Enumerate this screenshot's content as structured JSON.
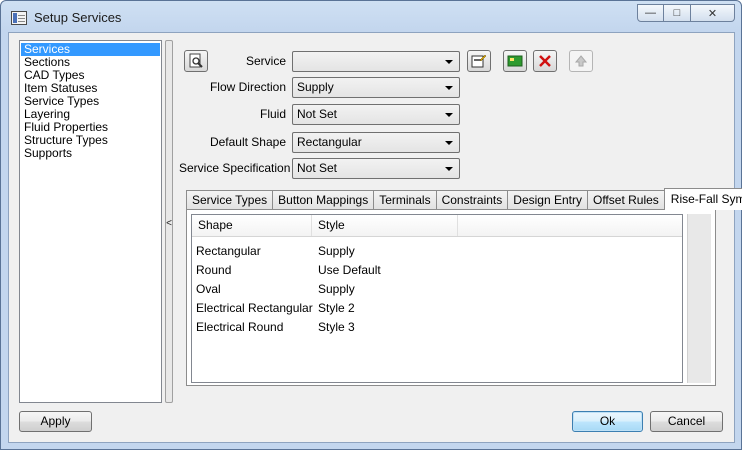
{
  "window": {
    "title": "Setup Services",
    "minimize_glyph": "—",
    "maximize_glyph": "□",
    "close_glyph": "✕"
  },
  "nav": {
    "items": [
      "Services",
      "Sections",
      "CAD Types",
      "Item Statuses",
      "Service Types",
      "Layering",
      "Fluid Properties",
      "Structure Types",
      "Supports"
    ],
    "selected": "Services"
  },
  "splitter": {
    "collapse_glyph": "<"
  },
  "form": {
    "service": {
      "label": "Service",
      "value": ""
    },
    "flow_direction": {
      "label": "Flow Direction",
      "value": "Supply"
    },
    "fluid": {
      "label": "Fluid",
      "value": "Not Set"
    },
    "default_shape": {
      "label": "Default Shape",
      "value": "Rectangular"
    },
    "service_specification": {
      "label": "Service Specification",
      "value": "Not Set"
    }
  },
  "tabs": {
    "items": [
      "Service Types",
      "Button Mappings",
      "Terminals",
      "Constraints",
      "Design Entry",
      "Offset Rules",
      "Rise-Fall Symbols"
    ],
    "active": "Rise-Fall Symbols"
  },
  "grid": {
    "columns": [
      "Shape",
      "Style"
    ],
    "rows": [
      [
        "Rectangular",
        "Supply"
      ],
      [
        "Round",
        "Use Default"
      ],
      [
        "Oval",
        "Supply"
      ],
      [
        "Electrical Rectangular",
        "Style 2"
      ],
      [
        "Electrical Round",
        "Style 3"
      ]
    ]
  },
  "buttons": {
    "apply": "Apply",
    "ok": "Ok",
    "cancel": "Cancel"
  },
  "icons": {
    "preview": "magnify-page-icon",
    "edit": "edit-service-icon",
    "add": "add-service-icon",
    "delete": "delete-icon",
    "up": "move-up-icon"
  },
  "colors": {
    "selection": "#3399ff",
    "delete_red": "#d01010",
    "add_green": "#2e9a2e"
  }
}
